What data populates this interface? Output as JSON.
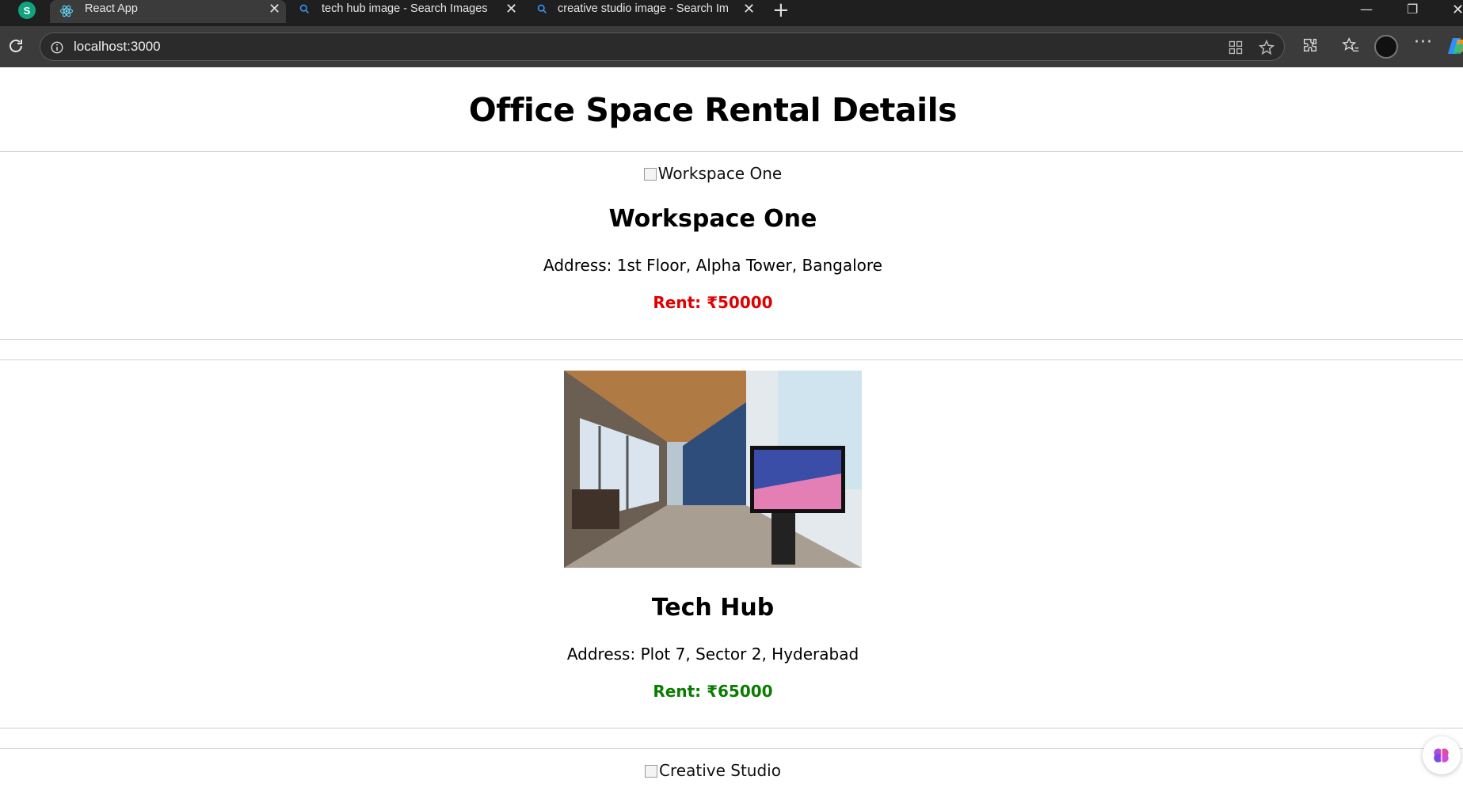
{
  "browser": {
    "tabs": [
      {
        "title": "React App",
        "active": true,
        "favicon": "react-icon"
      },
      {
        "title": "tech hub image - Search Images",
        "active": false,
        "favicon": "search-icon"
      },
      {
        "title": "creative studio image - Search Im",
        "active": false,
        "favicon": "search-icon"
      }
    ],
    "url": "localhost:3000"
  },
  "page": {
    "title": "Office Space Rental Details",
    "offices": [
      {
        "name": "Workspace One",
        "image_alt": "Workspace One",
        "address": "Address: 1st Floor, Alpha Tower, Bangalore",
        "rent": "Rent: ₹50000",
        "rent_color": "#e00000"
      },
      {
        "name": "Tech Hub",
        "image_alt": "",
        "address": "Address: Plot 7, Sector 2, Hyderabad",
        "rent": "Rent: ₹65000",
        "rent_color": "#0a7d00"
      },
      {
        "name": "",
        "image_alt": "Creative Studio",
        "address": "",
        "rent": "",
        "rent_color": ""
      }
    ]
  }
}
